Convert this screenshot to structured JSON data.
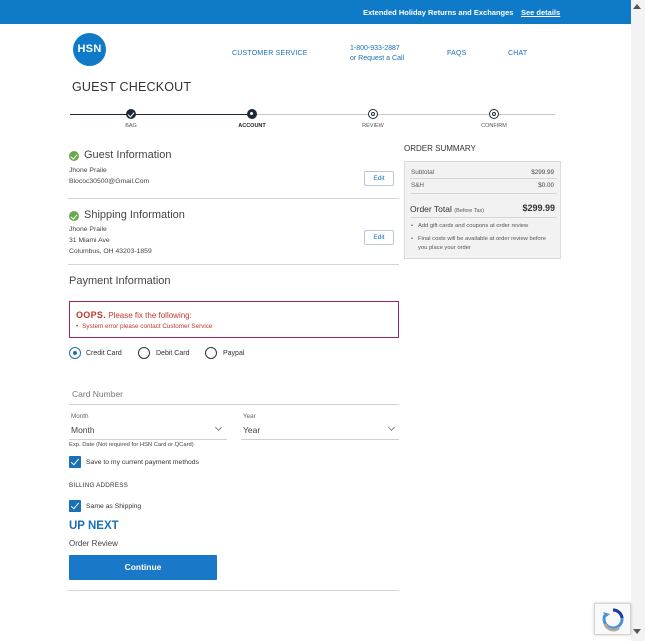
{
  "banner": {
    "text": "Extended Holiday Returns and Exchanges",
    "link": "See details"
  },
  "header": {
    "logo": "HSN",
    "customer_service": "CUSTOMER SERVICE",
    "phone": "1-800-933-2887",
    "request_call": "or Request a Call",
    "faqs": "FAQS",
    "chat": "CHAT"
  },
  "page_title": "GUEST CHECKOUT",
  "steps": [
    {
      "label": "BAG",
      "state": "done"
    },
    {
      "label": "ACCOUNT",
      "state": "current"
    },
    {
      "label": "REVIEW",
      "state": "todo"
    },
    {
      "label": "CONFIRM",
      "state": "todo"
    }
  ],
  "guest_info": {
    "title": "Guest Information",
    "name": "Jhone Praile",
    "email": "Blococ30500@Gmail.Com",
    "edit_label": "Edit"
  },
  "shipping_info": {
    "title": "Shipping Information",
    "name": "Jhone Praile",
    "address1": "31 Miami Ave",
    "address2": "Columbus, OH 43203-1859",
    "edit_label": "Edit"
  },
  "payment": {
    "title": "Payment Information",
    "error_title_bold": "OOPS.",
    "error_title_rest": " Please fix the following:",
    "error_item": "System error please contact Customer Service",
    "methods": [
      "Credit Card",
      "Debit Card",
      "Paypal"
    ],
    "selected_method": "Credit Card",
    "card_number_placeholder": "Card Number",
    "month_label": "Month",
    "month_value": "Month",
    "year_label": "Year",
    "year_value": "Year",
    "exp_note": "Exp. Date (Not required for HSN Card or QCard)",
    "save_label": "Save to my current payment methods",
    "save_checked": true,
    "billing_label": "BILLING ADDRESS",
    "same_as_shipping_label": "Same as Shipping",
    "same_as_shipping_checked": true
  },
  "up_next": {
    "title": "UP NEXT",
    "subtitle": "Order Review",
    "button": "Continue"
  },
  "order_summary": {
    "title": "ORDER SUMMARY",
    "subtotal_label": "Subtotal",
    "subtotal": "$299.99",
    "sh_label": "S&H",
    "sh": "$0.00",
    "total_label": "Order Total",
    "total_note": "(Before Tax)",
    "total": "$299.99",
    "bullets": [
      "Add gift cards and coupons at order review",
      "Final costs will be available at order review before you place your order"
    ]
  },
  "colors": {
    "primary": "#1a78c8",
    "banner": "#0f7ac8",
    "success": "#6aa84f",
    "error_border": "#9c2463",
    "error_text": "#c0392b"
  }
}
